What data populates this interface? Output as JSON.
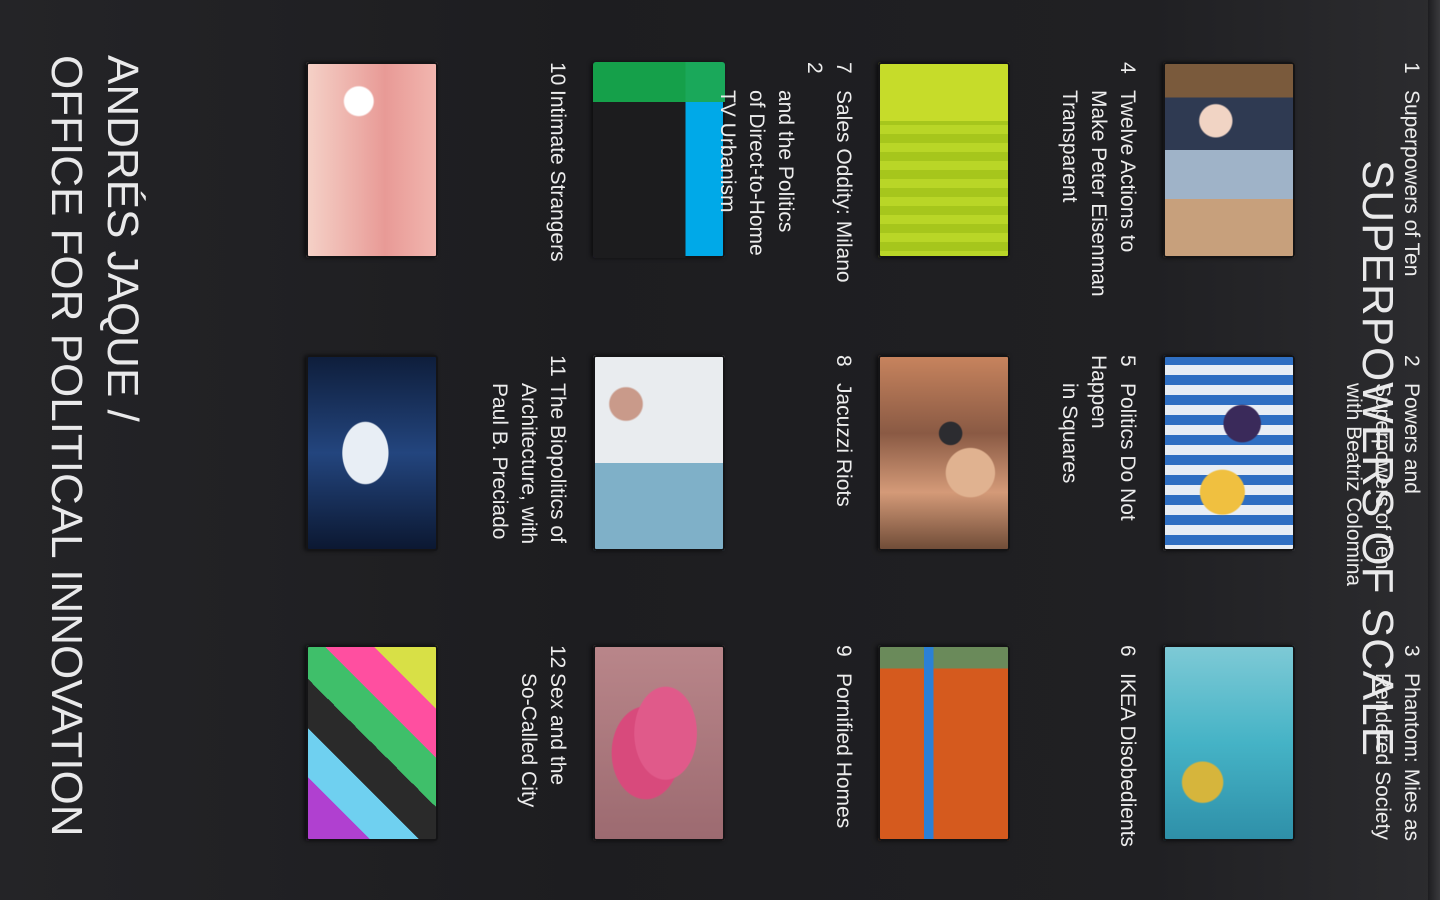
{
  "cover": {
    "title": "SUPERPOWERS OF SCALE",
    "author_line1": "ANDRÉS JAQUE /",
    "author_line2": "OFFICE FOR POLITICAL INNOVATION"
  },
  "chapters": [
    {
      "num": "1",
      "lines": [
        "Superpowers of Ten"
      ]
    },
    {
      "num": "2",
      "lines": [
        "Powers and",
        "Superpowers of Ten,",
        "with Beatriz Colomina"
      ]
    },
    {
      "num": "3",
      "lines": [
        "Phantom: Mies as",
        "Rendered Society"
      ]
    },
    {
      "num": "4",
      "lines": [
        "Twelve Actions to",
        "Make Peter Eisenman",
        "Transparent"
      ]
    },
    {
      "num": "5",
      "lines": [
        "Politics Do Not Happen",
        "in Squares"
      ]
    },
    {
      "num": "6",
      "lines": [
        "IKEA Disobedients"
      ]
    },
    {
      "num": "7",
      "lines": [
        "Sales Oddity: Milano 2",
        "and the Politics",
        "of Direct-to-Home",
        "TV Urbanism"
      ]
    },
    {
      "num": "8",
      "lines": [
        "Jacuzzi Riots"
      ]
    },
    {
      "num": "9",
      "lines": [
        "Pornified Homes"
      ]
    },
    {
      "num": "10",
      "lines": [
        "Intimate Strangers"
      ]
    },
    {
      "num": "11",
      "lines": [
        "The Biopolitics of",
        "Architecture, with",
        "Paul B. Preciado"
      ]
    },
    {
      "num": "12",
      "lines": [
        "Sex and the",
        "So-Called City"
      ]
    }
  ]
}
